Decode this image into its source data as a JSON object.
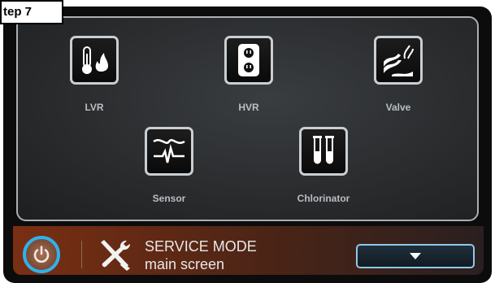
{
  "step_label": "tep 7",
  "tiles": [
    {
      "label": "LVR",
      "icon": "thermometer-flame-icon"
    },
    {
      "label": "HVR",
      "icon": "power-outlet-icon"
    },
    {
      "label": "Valve",
      "icon": "water-valve-icon"
    },
    {
      "label": "Sensor",
      "icon": "sensor-icon"
    },
    {
      "label": "Chlorinator",
      "icon": "test-tubes-icon"
    }
  ],
  "status": {
    "title": "SERVICE MODE",
    "subtitle": "main screen"
  },
  "colors": {
    "accent": "#2fb2ea",
    "bar_start": "#7a2f12",
    "tile_border": "#c9ced2"
  }
}
